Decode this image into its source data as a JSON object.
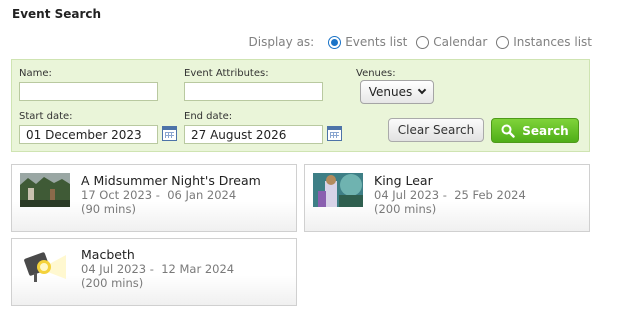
{
  "page": {
    "title": "Event Search"
  },
  "display": {
    "label": "Display as:",
    "options": [
      {
        "label": "Events list",
        "selected": true
      },
      {
        "label": "Calendar",
        "selected": false
      },
      {
        "label": "Instances list",
        "selected": false
      }
    ]
  },
  "filters": {
    "name_label": "Name:",
    "name_value": "",
    "attributes_label": "Event Attributes:",
    "attributes_value": "",
    "venues_label": "Venues:",
    "venues_button": "Venues",
    "start_label": "Start date:",
    "start_value": "01 December 2023",
    "end_label": "End date:",
    "end_value": "27 August 2026",
    "clear_label": "Clear Search",
    "search_label": "Search"
  },
  "events": [
    {
      "title": "A Midsummer Night's Dream",
      "dates": "17 Oct 2023 -  06 Jan 2024",
      "duration": "(90 mins)"
    },
    {
      "title": "King Lear",
      "dates": "04 Jul 2023 -  25 Feb 2024",
      "duration": "(200 mins)"
    },
    {
      "title": "Macbeth",
      "dates": "04 Jul 2023 -  12 Mar 2024",
      "duration": "(200 mins)"
    }
  ],
  "colors": {
    "accent_green": "#5cb81f",
    "radio_blue": "#1a73c7",
    "panel_bg": "#eaf5d9"
  }
}
